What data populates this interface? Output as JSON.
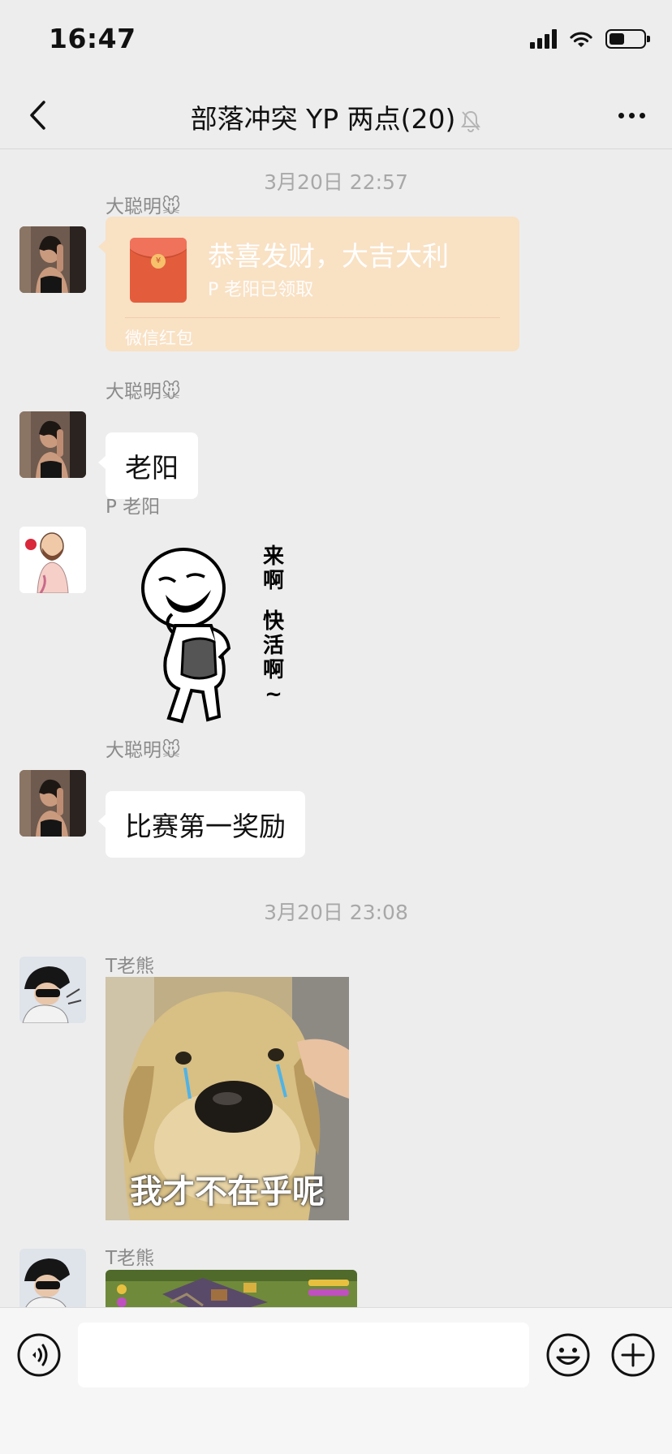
{
  "status_bar": {
    "time": "16:47"
  },
  "nav": {
    "title": "部落冲突 YP 两点(20)"
  },
  "messages": {
    "ts1": "3月20日 22:57",
    "m1": {
      "sender": "大聪明🐭",
      "redpacket_title": "恭喜发财，大吉大利",
      "redpacket_status": "P 老阳已领取",
      "redpacket_footer": "微信红包"
    },
    "m2": {
      "sender": "大聪明🐭",
      "text": "老阳"
    },
    "m3": {
      "sender": "P 老阳",
      "sticker_caption_1": "来啊",
      "sticker_caption_2": "快活啊~"
    },
    "m4": {
      "sender": "大聪明🐭",
      "text": "比赛第一奖励"
    },
    "ts2": "3月20日 23:08",
    "m5": {
      "sender": "T老熊",
      "sticker_caption": "我才不在乎呢"
    },
    "m6": {
      "sender": "T老熊"
    }
  },
  "input": {
    "placeholder": ""
  },
  "colors": {
    "background": "#ededed",
    "bubble": "#ffffff",
    "redpacket": "#f9e1c4",
    "timestamp": "#a8a8a8"
  }
}
